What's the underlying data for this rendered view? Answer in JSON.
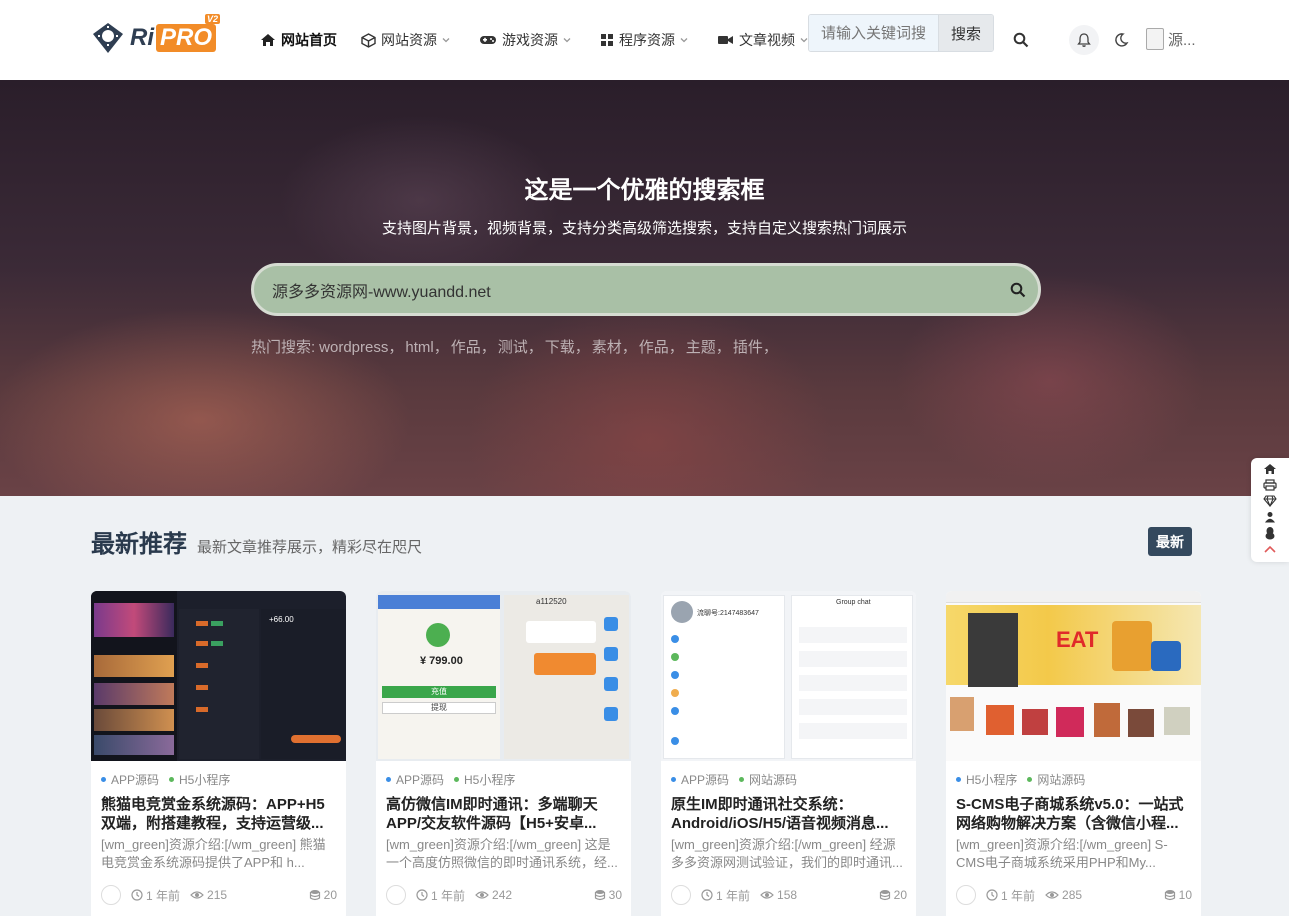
{
  "header": {
    "logo": {
      "ri": "Ri",
      "pro": "PRO",
      "version": "V2"
    },
    "nav": [
      {
        "label": "网站首页",
        "icon": "home-icon",
        "active": true,
        "dropdown": false
      },
      {
        "label": "网站资源",
        "icon": "cube-icon",
        "active": false,
        "dropdown": true
      },
      {
        "label": "游戏资源",
        "icon": "gamepad-icon",
        "active": false,
        "dropdown": true
      },
      {
        "label": "程序资源",
        "icon": "grid-icon",
        "active": false,
        "dropdown": true
      },
      {
        "label": "文章视频",
        "icon": "video-icon",
        "active": false,
        "dropdown": true
      }
    ],
    "search": {
      "placeholder": "请输入关键词搜索",
      "button": "搜索"
    },
    "user_name": "源..."
  },
  "hero": {
    "title": "这是一个优雅的搜索框",
    "subtitle": "支持图片背景，视频背景，支持分类高级筛选搜索，支持自定义搜索热门词展示",
    "search_value": "源多多资源网-www.yuandd.net",
    "hot_label": "热门搜索:",
    "hot_terms": [
      "wordpress，",
      "html，",
      "作品，",
      "测试，",
      "下载，",
      "素材，",
      "作品，",
      "主题，",
      "插件，"
    ]
  },
  "section": {
    "title": "最新推荐",
    "subtitle": "最新文章推荐展示，精彩尽在咫尺",
    "tag": "最新"
  },
  "colors": {
    "accent": "#34495e",
    "logo_orange": "#f28c28",
    "dot_blue": "#3a8ee6",
    "dot_green": "#5cb85c"
  },
  "cards": [
    {
      "cats": [
        "APP源码",
        "H5小程序"
      ],
      "title": "熊猫电竞赏金系统源码：APP+H5双端，附搭建教程，支持运营级...",
      "excerpt": "[wm_green]资源介绍:[/wm_green] 熊猫电竞赏金系统源码提供了APP和 h...",
      "time": "1 年前",
      "views": "215",
      "comments": "20",
      "thumb_text": {
        "amount": "+66.00"
      }
    },
    {
      "cats": [
        "APP源码",
        "H5小程序"
      ],
      "title": "高仿微信IM即时通讯：多端聊天APP/交友软件源码【H5+安卓...",
      "excerpt": "[wm_green]资源介绍:[/wm_green] 这是一个高度仿照微信的即时通讯系统，经...",
      "time": "1 年前",
      "views": "242",
      "comments": "30",
      "thumb_text": {
        "price": "¥ 799.00",
        "account": "a112520",
        "btn1": "充值",
        "btn2": "提现"
      }
    },
    {
      "cats": [
        "APP源码",
        "网站源码"
      ],
      "title": "原生IM即时通讯社交系统：Android/iOS/H5/语音视频消息...",
      "excerpt": "[wm_green]资源介绍:[/wm_green] 经源多多资源网测试验证，我们的即时通讯...",
      "time": "1 年前",
      "views": "158",
      "comments": "20",
      "thumb_text": {
        "id": "流聊号:2147483647",
        "group": "Group chat"
      }
    },
    {
      "cats": [
        "H5小程序",
        "网站源码"
      ],
      "title": "S-CMS电子商城系统v5.0：一站式网络购物解决方案（含微信小程...",
      "excerpt": "[wm_green]资源介绍:[/wm_green] S-CMS电子商城系统采用PHP和My...",
      "time": "1 年前",
      "views": "285",
      "comments": "10",
      "thumb_text": {
        "eat": "EAT"
      }
    }
  ]
}
